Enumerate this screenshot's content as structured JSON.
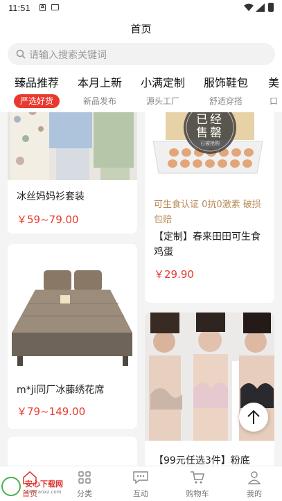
{
  "status": {
    "time": "11:51"
  },
  "header": {
    "title": "首页"
  },
  "search": {
    "placeholder": "请输入搜索关键词"
  },
  "categories": [
    {
      "main": "臻品推荐",
      "sub": "严选好货",
      "active": true
    },
    {
      "main": "本月上新",
      "sub": "新品发布"
    },
    {
      "main": "小满定制",
      "sub": "源头工厂"
    },
    {
      "main": "服饰鞋包",
      "sub": "舒适穿搭"
    },
    {
      "main": "美",
      "sub": "口"
    }
  ],
  "products": [
    {
      "name": "冰丝妈妈衫套装",
      "price": "￥59~79.00"
    },
    {
      "note": "可生食认证 0抗0激素 破损包赔",
      "name": "【定制】春来田田可生食鸡蛋",
      "price": "￥29.90",
      "stamp_line1": "已经",
      "stamp_line2": "售罄",
      "stamp_line3": "已被抢购"
    },
    {
      "name": "m*ji同厂冰藤绣花席",
      "price": "￥79~149.00"
    },
    {
      "name": "【99元任选3件】粉底"
    }
  ],
  "tabbar": [
    {
      "label": "首页",
      "active": true
    },
    {
      "label": "分类"
    },
    {
      "label": "互动"
    },
    {
      "label": "购物车"
    },
    {
      "label": "我的"
    }
  ],
  "watermark": {
    "title": "安心下载网",
    "url": "www.anxz.com"
  },
  "colors": {
    "accent": "#e8392e",
    "note": "#b98a56"
  },
  "icons": [
    "search-icon",
    "back-to-top-icon",
    "home-icon",
    "category-icon",
    "interact-icon",
    "cart-icon",
    "profile-icon"
  ]
}
